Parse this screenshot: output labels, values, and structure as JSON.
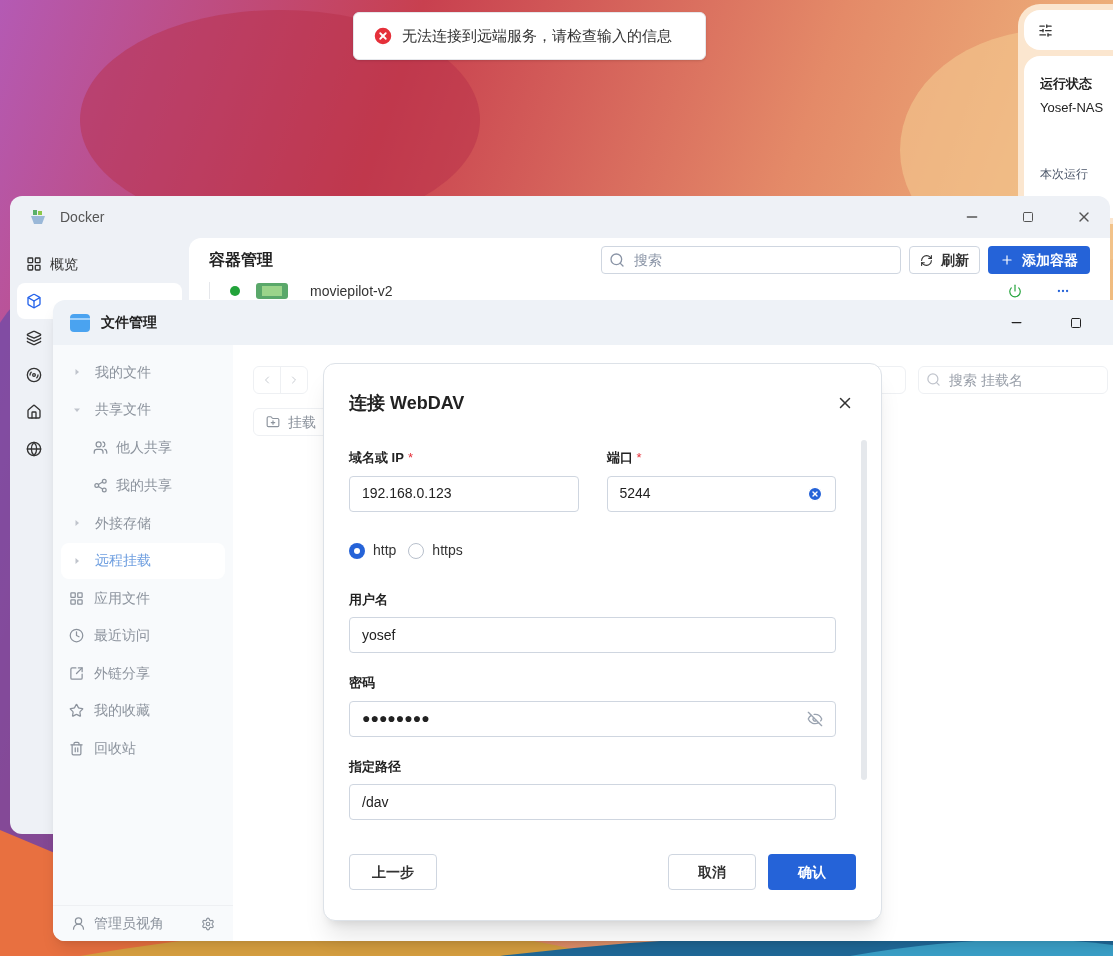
{
  "toast": {
    "kind": "error",
    "message": "无法连接到远端服务，请检查输入的信息"
  },
  "widget": {
    "title": "运行状态",
    "device": "Yosef-NAS",
    "label": "本次运行"
  },
  "docker_window": {
    "title": "Docker",
    "sidebar": [
      {
        "label": "概览",
        "selected": false
      },
      {
        "selected": true
      },
      {
        "selected": false
      },
      {
        "selected": false
      },
      {
        "selected": false
      },
      {
        "selected": false
      }
    ],
    "panel": {
      "title": "容器管理",
      "search": {
        "placeholder": "搜索"
      },
      "buttons": [
        {
          "kind": "refresh",
          "label": "刷新"
        },
        {
          "kind": "add",
          "label": "添加容器"
        }
      ],
      "row": {
        "name": "moviepilot-v2",
        "running": true
      }
    }
  },
  "file_window": {
    "title": "文件管理",
    "sidebar": [
      {
        "label": "我的文件",
        "expanded": false,
        "selected": false
      },
      {
        "label": "共享文件",
        "expanded": true,
        "selected": false,
        "children": [
          {
            "label": "他人共享",
            "selected": false
          },
          {
            "label": "我的共享",
            "selected": false
          }
        ]
      },
      {
        "label": "外接存储",
        "expanded": false,
        "selected": false
      },
      {
        "label": "远程挂载",
        "expanded": false,
        "selected": true
      },
      {
        "label": "应用文件",
        "selected": false
      },
      {
        "label": "最近访问",
        "selected": false
      },
      {
        "label": "外链分享",
        "selected": false
      },
      {
        "label": "我的收藏",
        "selected": false
      },
      {
        "label": "回收站",
        "selected": false
      }
    ],
    "footer": "管理员视角",
    "toolbar": {
      "search": {
        "placeholder": "搜索 挂载名"
      },
      "mount_button": "挂载"
    }
  },
  "dialog": {
    "title": "连接 WebDAV",
    "host": {
      "label": "域名或 IP",
      "required_mark": "*",
      "value": "192.168.0.123"
    },
    "port": {
      "label": "端口",
      "required_mark": "*",
      "value": "5244"
    },
    "protocols": [
      {
        "label": "http",
        "selected": true
      },
      {
        "label": "https",
        "selected": false
      }
    ],
    "username": {
      "label": "用户名",
      "value": "yosef"
    },
    "password": {
      "label": "密码",
      "value": "●●●●●●●●"
    },
    "path": {
      "label": "指定路径",
      "value": "/dav"
    },
    "buttons": {
      "back": "上一步",
      "cancel": "取消",
      "confirm": "确认"
    }
  }
}
